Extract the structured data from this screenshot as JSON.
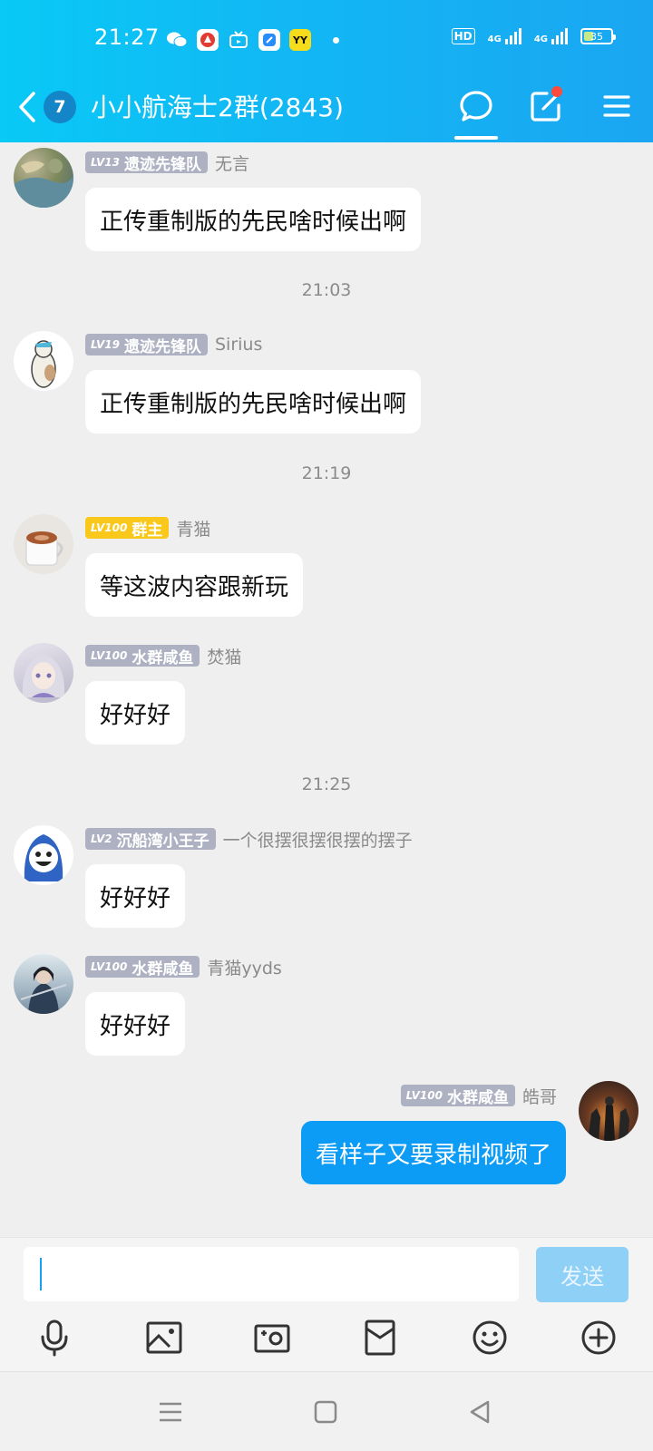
{
  "status_bar": {
    "time": "21:27",
    "battery": "35",
    "hd_badge": "HD",
    "network_1": "4G",
    "network_2": "4G",
    "yy_app": "YY"
  },
  "header": {
    "unread_count": "7",
    "group_title": "小小航海士2群(2843)"
  },
  "messages": [
    {
      "level": "LV13",
      "title": "遗迹先锋队",
      "nick": "无言",
      "text": "正传重制版的先民啥时候出啊"
    },
    {
      "timestamp": "21:03"
    },
    {
      "level": "LV19",
      "title": "遗迹先锋队",
      "nick": "Sirius",
      "text": "正传重制版的先民啥时候出啊"
    },
    {
      "timestamp": "21:19"
    },
    {
      "level": "LV100",
      "title": "群主",
      "nick": "青猫",
      "text": "等这波内容跟新玩"
    },
    {
      "level": "LV100",
      "title": "水群咸鱼",
      "nick": "焚猫",
      "text": "好好好"
    },
    {
      "timestamp": "21:25"
    },
    {
      "level": "LV2",
      "title": "沉船湾小王子",
      "nick": "一个很摆很摆很摆的摆子",
      "text": "好好好"
    },
    {
      "level": "LV100",
      "title": "水群咸鱼",
      "nick": "青猫yyds",
      "text": "好好好"
    },
    {
      "level": "LV100",
      "title": "水群咸鱼",
      "nick": "皓哥",
      "text": "看样子又要录制视频了",
      "self": true
    }
  ],
  "input": {
    "value": "",
    "send_label": "发送"
  },
  "colors": {
    "header_gradient_start": "#09c9f6",
    "header_gradient_end": "#1aa6f1",
    "self_bubble": "#0d9cf5",
    "level_badge": "#aeb1c2",
    "owner_badge": "#f9c81a",
    "send_button_disabled": "#8fd0f7"
  }
}
